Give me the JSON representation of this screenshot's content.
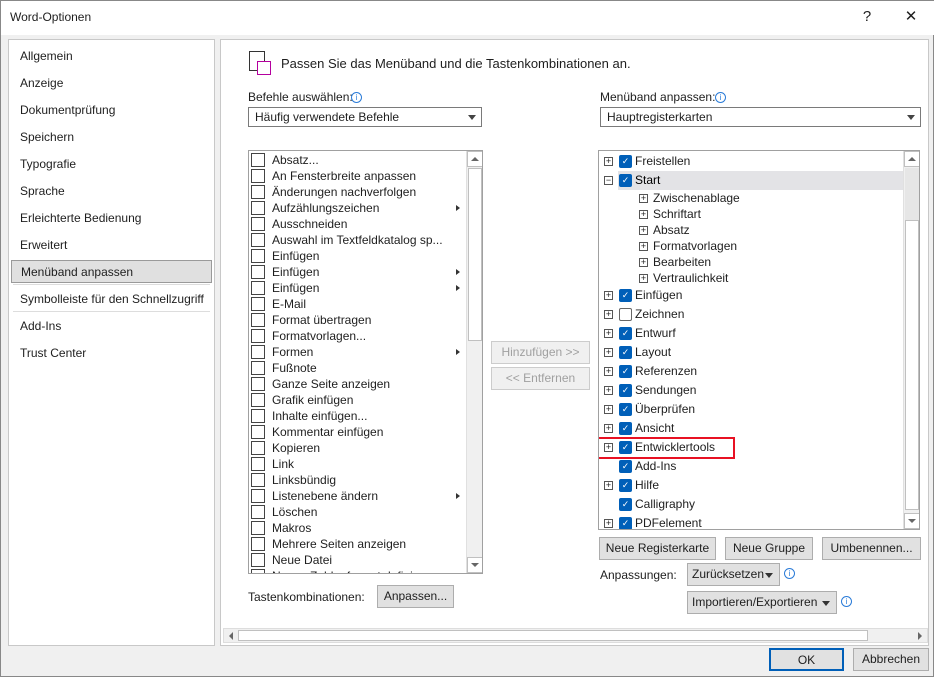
{
  "window": {
    "title": "Word-Optionen",
    "help": "?",
    "close": "✕"
  },
  "nav": {
    "items": [
      {
        "label": "Allgemein"
      },
      {
        "label": "Anzeige"
      },
      {
        "label": "Dokumentprüfung"
      },
      {
        "label": "Speichern"
      },
      {
        "label": "Typografie"
      },
      {
        "label": "Sprache"
      },
      {
        "label": "Erleichterte Bedienung"
      },
      {
        "label": "Erweitert"
      },
      {
        "label": "Menüband anpassen",
        "selected": true
      },
      {
        "label": "Symbolleiste für den Schnellzugriff"
      },
      {
        "label": "Add-Ins"
      },
      {
        "label": "Trust Center"
      }
    ]
  },
  "main": {
    "heading": "Passen Sie das Menüband und die Tastenkombinationen an.",
    "commands_label": "Befehle auswählen:",
    "commands_value": "Häufig verwendete Befehle",
    "ribbon_label": "Menüband anpassen:",
    "ribbon_value": "Hauptregisterkarten",
    "commands": [
      {
        "label": "Absatz...",
        "icon": "paragraph-icon"
      },
      {
        "label": "An Fensterbreite anpassen",
        "icon": "fit-width-icon"
      },
      {
        "label": "Änderungen nachverfolgen",
        "icon": "track-changes-icon"
      },
      {
        "label": "Aufzählungszeichen",
        "icon": "bullets-icon",
        "submenu": true
      },
      {
        "label": "Ausschneiden",
        "icon": "scissors-icon"
      },
      {
        "label": "Auswahl im Textfeldkatalog sp...",
        "icon": "save-icon"
      },
      {
        "label": "Einfügen",
        "icon": "paste-icon"
      },
      {
        "label": "Einfügen",
        "icon": "paste-icon",
        "submenu": true
      },
      {
        "label": "Einfügen",
        "icon": "paste-icon",
        "submenu": true
      },
      {
        "label": "E-Mail",
        "icon": "email-icon"
      },
      {
        "label": "Format übertragen",
        "icon": "format-painter-icon"
      },
      {
        "label": "Formatvorlagen...",
        "icon": "styles-icon"
      },
      {
        "label": "Formen",
        "icon": "shapes-icon",
        "submenu": true
      },
      {
        "label": "Fußnote",
        "icon": "footnote-icon"
      },
      {
        "label": "Ganze Seite anzeigen",
        "icon": "page-icon"
      },
      {
        "label": "Grafik einfügen",
        "icon": "picture-icon"
      },
      {
        "label": "Inhalte einfügen...",
        "icon": "paste-special-icon"
      },
      {
        "label": "Kommentar einfügen",
        "icon": "comment-icon"
      },
      {
        "label": "Kopieren",
        "icon": "copy-icon"
      },
      {
        "label": "Link",
        "icon": "link-icon"
      },
      {
        "label": "Linksbündig",
        "icon": "align-left-icon"
      },
      {
        "label": "Listenebene ändern",
        "icon": "list-level-icon",
        "submenu": true
      },
      {
        "label": "Löschen",
        "icon": "delete-comment-icon"
      },
      {
        "label": "Makros",
        "icon": "macro-play-icon"
      },
      {
        "label": "Mehrere Seiten anzeigen",
        "icon": "multi-page-icon"
      },
      {
        "label": "Neue Datei",
        "icon": "new-file-icon"
      },
      {
        "label": "Neues Zahlenformat definieren...",
        "icon": "number-format-icon"
      }
    ],
    "add_button": "Hinzufügen >>",
    "remove_button": "<< Entfernen",
    "tabs": [
      {
        "label": "Freistellen",
        "checked": true,
        "expand": "+"
      },
      {
        "label": "Start",
        "checked": true,
        "expand": "-",
        "selected": true,
        "children": [
          "Zwischenablage",
          "Schriftart",
          "Absatz",
          "Formatvorlagen",
          "Bearbeiten",
          "Vertraulichkeit"
        ]
      },
      {
        "label": "Einfügen",
        "checked": true,
        "expand": "+"
      },
      {
        "label": "Zeichnen",
        "checked": false,
        "expand": "+"
      },
      {
        "label": "Entwurf",
        "checked": true,
        "expand": "+"
      },
      {
        "label": "Layout",
        "checked": true,
        "expand": "+"
      },
      {
        "label": "Referenzen",
        "checked": true,
        "expand": "+"
      },
      {
        "label": "Sendungen",
        "checked": true,
        "expand": "+"
      },
      {
        "label": "Überprüfen",
        "checked": true,
        "expand": "+"
      },
      {
        "label": "Ansicht",
        "checked": true,
        "expand": "+"
      },
      {
        "label": "Entwicklertools",
        "checked": true,
        "expand": "+",
        "highlighted": true
      },
      {
        "label": "Add-Ins",
        "checked": true,
        "expand": ""
      },
      {
        "label": "Hilfe",
        "checked": true,
        "expand": "+"
      },
      {
        "label": "Calligraphy",
        "checked": true,
        "expand": ""
      },
      {
        "label": "PDFelement",
        "checked": true,
        "expand": "+"
      }
    ],
    "new_tab_button": "Neue Registerkarte",
    "new_group_button": "Neue Gruppe",
    "rename_button": "Umbenennen...",
    "customizations_label": "Anpassungen:",
    "reset_button": "Zurücksetzen",
    "import_export_button": "Importieren/Exportieren",
    "shortcuts_label": "Tastenkombinationen:",
    "shortcuts_button": "Anpassen..."
  },
  "footer": {
    "ok": "OK",
    "cancel": "Abbrechen"
  },
  "colors": {
    "accent": "#005fb8",
    "highlight": "#e81123"
  }
}
